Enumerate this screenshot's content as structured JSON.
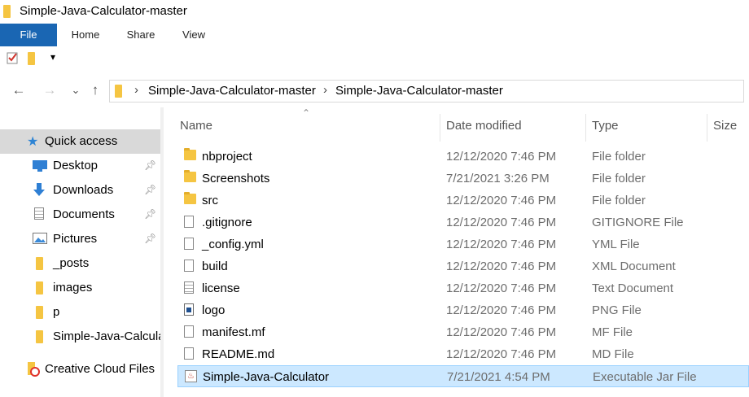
{
  "window": {
    "title": "Simple-Java-Calculator-master"
  },
  "ribbon": {
    "tabs": [
      "File",
      "Home",
      "Share",
      "View"
    ]
  },
  "qat": {
    "dropdown": "▾"
  },
  "nav": {
    "back": "←",
    "forward": "→",
    "recent": "⌄",
    "up": "↑",
    "breadcrumb": [
      "Simple-Java-Calculator-master",
      "Simple-Java-Calculator-master"
    ],
    "separator": "›"
  },
  "sidebar": {
    "items": [
      {
        "label": "Quick access",
        "icon": "star-icon"
      },
      {
        "label": "Desktop",
        "icon": "desktop-icon",
        "pinned": true
      },
      {
        "label": "Downloads",
        "icon": "download-icon",
        "pinned": true
      },
      {
        "label": "Documents",
        "icon": "documents-icon",
        "pinned": true
      },
      {
        "label": "Pictures",
        "icon": "pictures-icon",
        "pinned": true
      },
      {
        "label": "_posts",
        "icon": "folder-icon"
      },
      {
        "label": "images",
        "icon": "folder-icon"
      },
      {
        "label": "p",
        "icon": "folder-icon"
      },
      {
        "label": "Simple-Java-Calcula",
        "icon": "folder-icon"
      },
      {
        "label": "Creative Cloud Files",
        "icon": "creative-cloud-icon"
      }
    ]
  },
  "columns": {
    "name": "Name",
    "date": "Date modified",
    "type": "Type",
    "size": "Size"
  },
  "files": [
    {
      "name": "nbproject",
      "date": "12/12/2020 7:46 PM",
      "type": "File folder",
      "icon": "folder-icon"
    },
    {
      "name": "Screenshots",
      "date": "7/21/2021 3:26 PM",
      "type": "File folder",
      "icon": "folder-icon"
    },
    {
      "name": "src",
      "date": "12/12/2020 7:46 PM",
      "type": "File folder",
      "icon": "folder-icon"
    },
    {
      "name": ".gitignore",
      "date": "12/12/2020 7:46 PM",
      "type": "GITIGNORE File",
      "icon": "file-icon"
    },
    {
      "name": "_config.yml",
      "date": "12/12/2020 7:46 PM",
      "type": "YML File",
      "icon": "file-icon"
    },
    {
      "name": "build",
      "date": "12/12/2020 7:46 PM",
      "type": "XML Document",
      "icon": "file-icon"
    },
    {
      "name": "license",
      "date": "12/12/2020 7:46 PM",
      "type": "Text Document",
      "icon": "text-file-icon"
    },
    {
      "name": "logo",
      "date": "12/12/2020 7:46 PM",
      "type": "PNG File",
      "icon": "image-file-icon"
    },
    {
      "name": "manifest.mf",
      "date": "12/12/2020 7:46 PM",
      "type": "MF File",
      "icon": "file-icon"
    },
    {
      "name": "README.md",
      "date": "12/12/2020 7:46 PM",
      "type": "MD File",
      "icon": "file-icon"
    },
    {
      "name": "Simple-Java-Calculator",
      "date": "7/21/2021 4:54 PM",
      "type": "Executable Jar File",
      "icon": "jar-icon",
      "selected": true
    }
  ],
  "colors": {
    "accent": "#1a66b3",
    "selection": "#cce8ff",
    "selection_border": "#99d1ff",
    "folder": "#f5c542"
  }
}
